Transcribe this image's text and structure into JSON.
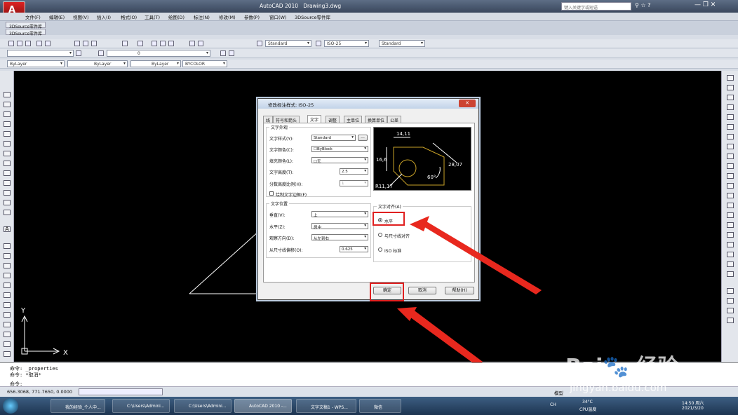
{
  "app": {
    "title": "AutoCAD 2010",
    "drawing": "Drawing3.dwg",
    "search_placeholder": "键入关键字或短语"
  },
  "menu": [
    "文件(F)",
    "编辑(E)",
    "视图(V)",
    "插入(I)",
    "格式(O)",
    "工具(T)",
    "绘图(D)",
    "标注(N)",
    "修改(M)",
    "参数(P)",
    "窗口(W)",
    "3DSource零件库"
  ],
  "tabs": {
    "top": "3DSource零件库",
    "second": "3DSource零件库"
  },
  "toolbar": {
    "textstyle": "Standard",
    "dimstyle": "ISO-25",
    "tablestyle": "Standard",
    "layer": "0",
    "color": "ByLayer",
    "linetype": "ByLayer",
    "lineweight": "ByLayer",
    "plotstyle": "BYCOLOR"
  },
  "ucs": {
    "y": "Y",
    "x": "X"
  },
  "dialog": {
    "title": "修改标注样式: ISO-25",
    "close": "✕",
    "tabs": [
      "线",
      "符号和箭头",
      "文字",
      "调整",
      "主单位",
      "换算单位",
      "公差"
    ],
    "appearance": {
      "group": "文字外观",
      "style_label": "文字样式(Y):",
      "style": "Standard",
      "browse": "...",
      "color_label": "文字颜色(C):",
      "color": "ByBlock",
      "fill_label": "填充颜色(L):",
      "fill": "无",
      "height_label": "文字高度(T):",
      "height": "2.5",
      "frac_label": "分数高度比例(H):",
      "frac": "1",
      "frame_label": "绘制文字边框(F)"
    },
    "placement": {
      "group": "文字位置",
      "vert_label": "垂直(V):",
      "vert": "上",
      "horiz_label": "水平(Z):",
      "horiz": "居中",
      "view_label": "观察方向(D):",
      "view": "从左到右",
      "offset_label": "从尺寸线偏移(O):",
      "offset": "0.625"
    },
    "alignment": {
      "group": "文字对齐(A)",
      "opt1": "水平",
      "opt2": "与尺寸线对齐",
      "opt3": "ISO 标准"
    },
    "preview": {
      "d1": "14,11",
      "d2": "16,6",
      "d3": "28,07",
      "d4": "60°",
      "d5": "R11,17"
    },
    "buttons": {
      "ok": "确定",
      "cancel": "取消",
      "help": "帮助(H)"
    }
  },
  "command": {
    "line1": "命令: _properties",
    "line2": "命令: *取消*",
    "prompt": "命令:"
  },
  "status": {
    "coords": "656.3068, 771.7650, 0.0000",
    "model": "模型"
  },
  "taskbar": {
    "items": [
      "我的经验_个人中...",
      "C:\\Users\\Admini...",
      "C:\\Users\\Admini...",
      "AutoCAD 2010 -...",
      "文字文稿1 - WPS...",
      "微信"
    ],
    "temp": "34°C",
    "cpu": "CPU温度",
    "time": "14:50 周六",
    "date": "2021/3/20",
    "lang": "CH"
  },
  "watermark": {
    "brand": "Bai",
    "brand2": "经验",
    "url": "jingyan.baidu.com"
  }
}
